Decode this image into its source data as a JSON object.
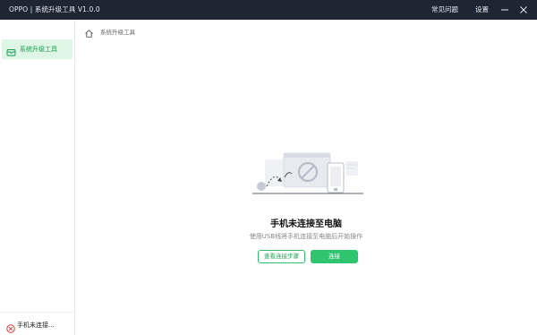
{
  "window": {
    "title": "OPPO | 系统升级工具  V1.0.0",
    "menu": {
      "faq": "常见问题",
      "settings": "设置"
    },
    "controls": [
      "minimize-icon",
      "close-icon"
    ]
  },
  "sidebar": {
    "items": [
      {
        "label": "系统升级工具",
        "icon": "device-upgrade-icon",
        "active": true
      }
    ],
    "status": {
      "label": "手机未连接...",
      "icon": "disconnected-icon",
      "color": "#e53935"
    }
  },
  "breadcrumb": {
    "home_icon": "home-icon",
    "current": "系统升级工具"
  },
  "empty_state": {
    "title": "手机未连接至电脑",
    "description": "使用USB线将手机连接至电脑后开始操作",
    "secondary_button": "查看连接步骤",
    "primary_button": "连接"
  },
  "colors": {
    "titlebar": "#1f2633",
    "accent": "#2ec56e",
    "active_nav_bg": "#dff5e6",
    "error": "#e53935"
  }
}
